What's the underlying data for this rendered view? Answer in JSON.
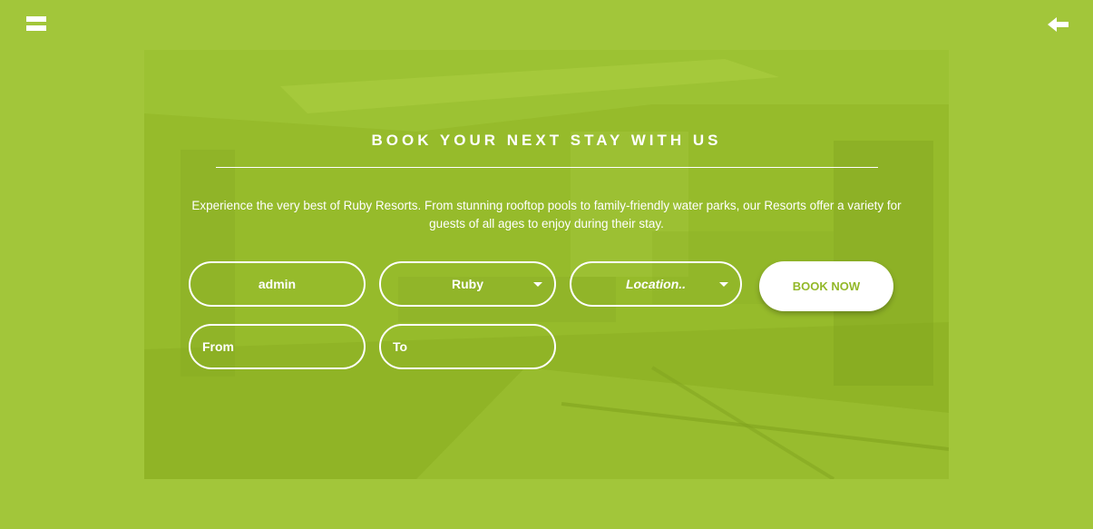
{
  "header": {
    "menu_icon": "hamburger-menu-icon",
    "back_icon": "arrow-left-icon"
  },
  "hero": {
    "title": "BOOK YOUR NEXT STAY WITH US",
    "description": "Experience the very best of Ruby Resorts. From stunning rooftop pools to family-friendly water parks, our Resorts offer a variety for guests of all ages to enjoy during their stay."
  },
  "form": {
    "username_value": "admin",
    "resort_select_value": "Ruby",
    "location_select_placeholder": "Location..",
    "from_placeholder": "From",
    "to_placeholder": "To",
    "book_button_label": "BOOK NOW"
  },
  "colors": {
    "background": "#a2c63a",
    "panel_overlay": "#93b829",
    "text": "#ffffff",
    "button_text": "#93b829"
  }
}
